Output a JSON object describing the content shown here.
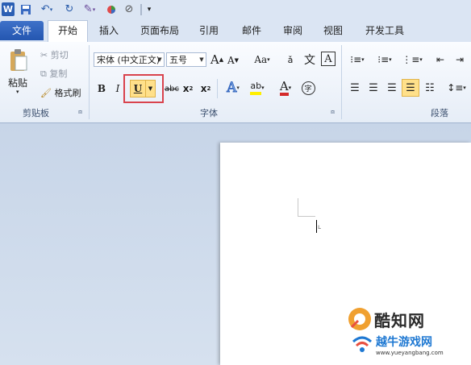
{
  "app_icon": "W",
  "quick_access": {
    "save_icon": "save-icon",
    "undo_icon": "undo-icon",
    "redo_icon": "repeat-icon"
  },
  "tabs": [
    "文件",
    "开始",
    "插入",
    "页面布局",
    "引用",
    "邮件",
    "审阅",
    "视图",
    "开发工具"
  ],
  "clipboard": {
    "paste": "粘贴",
    "cut": "剪切",
    "copy": "复制",
    "format_painter": "格式刷",
    "group": "剪贴板"
  },
  "font": {
    "name": "宋体 (中文正文)",
    "size": "五号",
    "grow": "A",
    "shrink": "A",
    "change_case": "Aa",
    "pinyin": "文",
    "border_char": "A",
    "bold": "B",
    "italic": "I",
    "underline": "U",
    "strike": "abc",
    "subscript": "x",
    "superscript": "x",
    "text_effect": "A",
    "highlight": "ab",
    "font_color": "A",
    "enclose": "字",
    "group": "字体"
  },
  "paragraph": {
    "group": "段落"
  },
  "watermark": {
    "brand": "酷知网",
    "brand2": "越牛游戏网",
    "url": "www.yueyangbang.com"
  },
  "colors": {
    "file_tab": "#2a5caa",
    "highlight_box": "#d9434d",
    "underline_active": "#ffe08a"
  }
}
